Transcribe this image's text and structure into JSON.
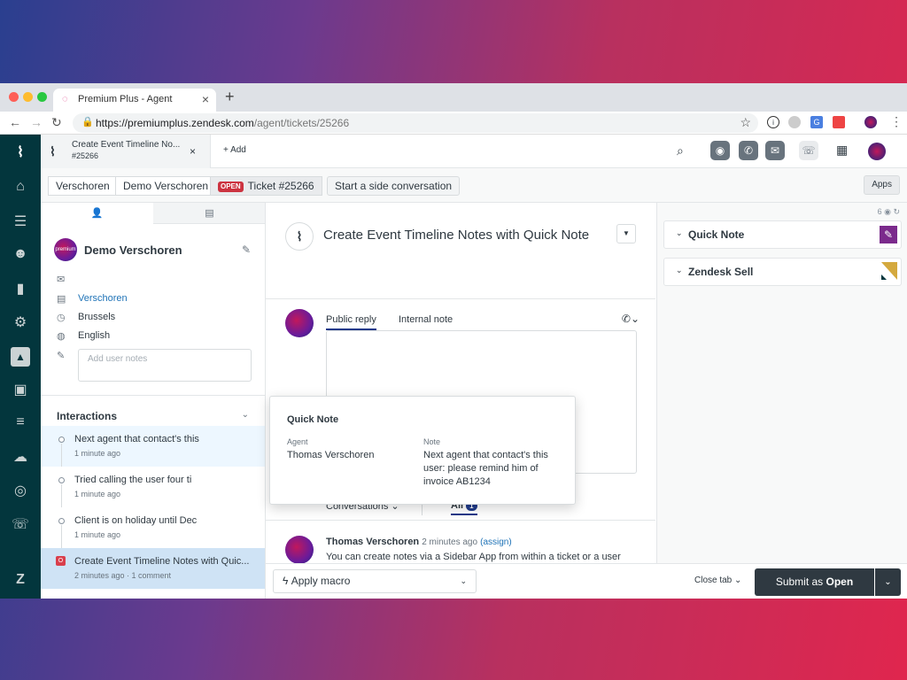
{
  "browser": {
    "tab_title": "Premium Plus - Agent",
    "tab_close": "×",
    "new_tab": "+",
    "url_host": "https://premiumplus.zendesk.com",
    "url_path": "/agent/tickets/25266"
  },
  "topbar": {
    "ticket_tab_title": "Create Event Timeline No...",
    "ticket_tab_id": "#25266",
    "ticket_tab_close": "×",
    "add_label": "+ Add"
  },
  "breadcrumb": {
    "org": "Verschoren",
    "user": "Demo Verschoren",
    "status_badge": "OPEN",
    "ticket": "Ticket #25266",
    "side_conversation": "Start a side conversation",
    "apps": "Apps"
  },
  "user_panel": {
    "name": "Demo Verschoren",
    "avatar_text": "premium plus",
    "organization": "Verschoren",
    "city": "Brussels",
    "language": "English",
    "notes_placeholder": "Add user notes"
  },
  "interactions": {
    "title": "Interactions",
    "items": [
      {
        "title": "Next agent that contact's this",
        "sub": "1 minute ago"
      },
      {
        "title": "Tried calling the user four ti",
        "sub": "1 minute ago"
      },
      {
        "title": "Client is on holiday until Dec",
        "sub": "1 minute ago"
      },
      {
        "title": "Create Event Timeline Notes with Quic...",
        "sub": "2 minutes ago · 1 comment"
      }
    ]
  },
  "ticket": {
    "subject": "Create Event Timeline Notes with Quick Note",
    "reply_tab_public": "Public reply",
    "reply_tab_internal": "Internal note",
    "conv_tab": "Conversations",
    "all_tab": "All",
    "all_count": "1",
    "comment_author": "Thomas Verschoren",
    "comment_time": "2 minutes ago",
    "comment_assign": "(assign)",
    "comment_body": "You can create notes via a Sidebar App from within a ticket or a user"
  },
  "popup": {
    "title": "Quick Note",
    "agent_label": "Agent",
    "agent_value": "Thomas Verschoren",
    "note_label": "Note",
    "note_value": "Next agent that contact's this user: please remind him of invoice AB1234"
  },
  "apps_panel": {
    "meta": "6",
    "quick_note": "Quick Note",
    "zendesk_sell": "Zendesk Sell"
  },
  "footer": {
    "apply_macro": "Apply macro",
    "close_tab": "Close tab",
    "submit_prefix": "Submit as ",
    "submit_status": "Open"
  },
  "colors": {
    "nav_bg": "#03363d",
    "primary": "#2f3941",
    "open_badge": "#cc3340",
    "link": "#1f73b7",
    "quick_note_icon": "#7b2a8c"
  }
}
